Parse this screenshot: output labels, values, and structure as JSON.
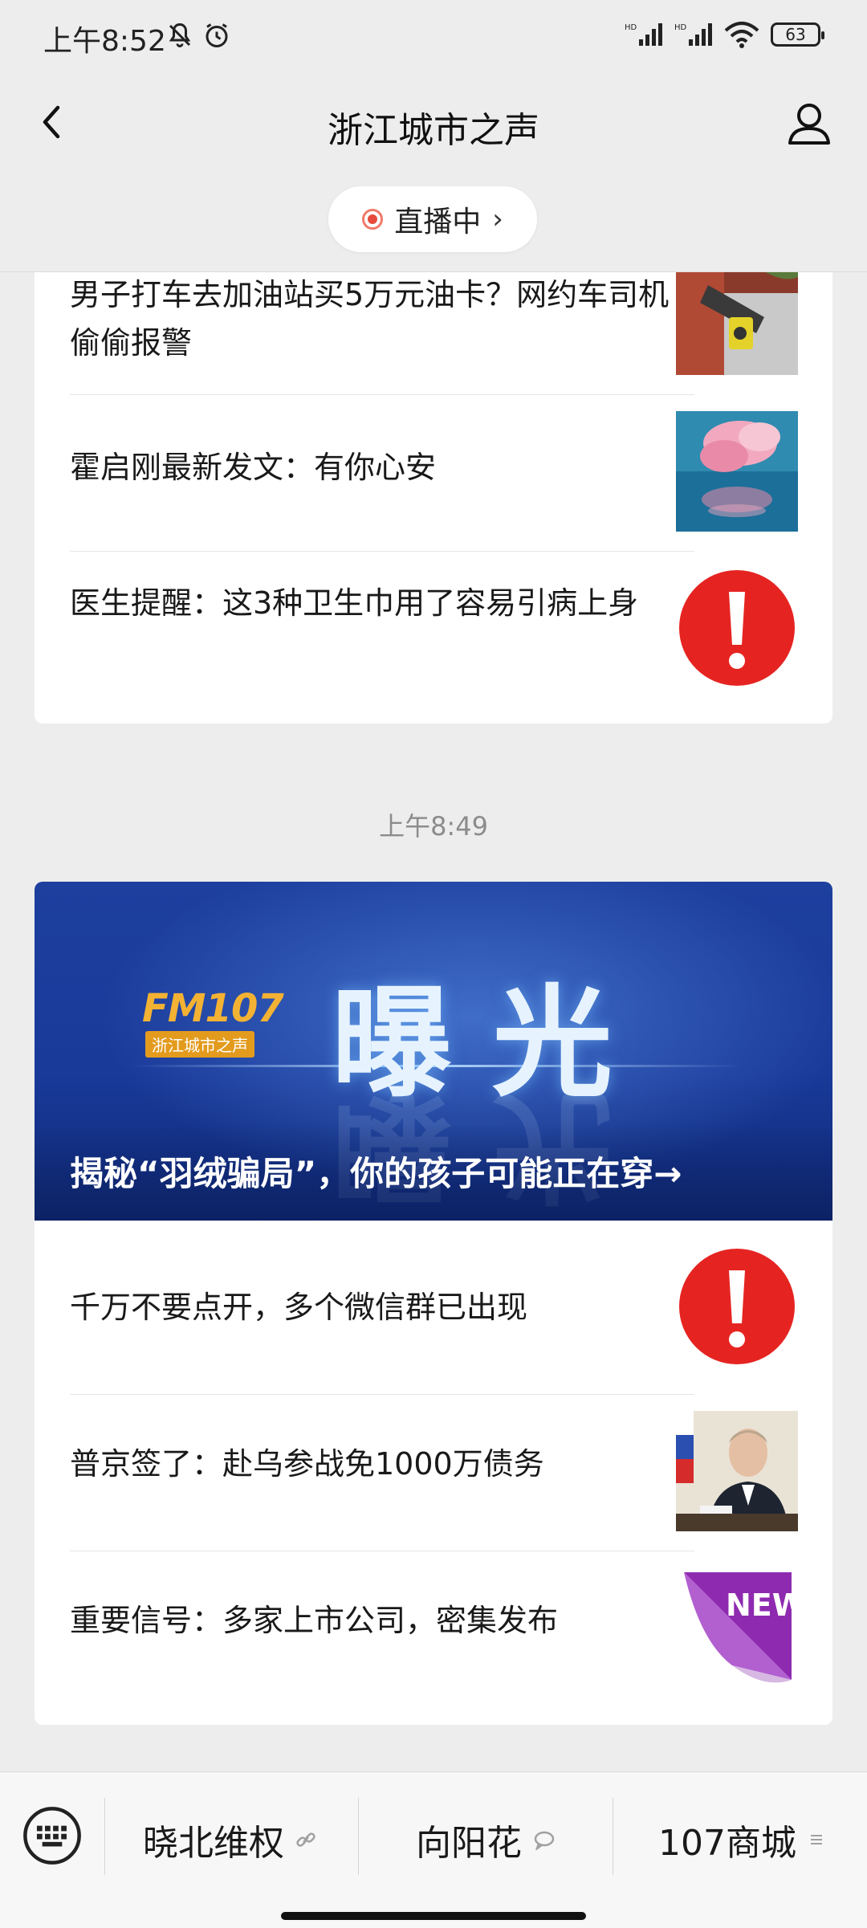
{
  "status_bar": {
    "time": "上午8:52",
    "signal_1": "ᴴᴰ",
    "signal_2": "ᴴᴰ",
    "battery": "63"
  },
  "header": {
    "title": "浙江城市之声"
  },
  "live": {
    "label": "直播中",
    "chevron": "›"
  },
  "card1": {
    "items": [
      {
        "text": "男子打车去加油站买5万元油卡？网约车司机偷偷报警",
        "thumb": "gas-pump-photo"
      },
      {
        "text": "霍启刚最新发文：有你心安",
        "thumb": "pink-flower-photo"
      },
      {
        "text": "医生提醒：这3种卫生巾用了容易引病上身",
        "thumb": "warning-icon"
      }
    ]
  },
  "timestamp": "上午8:49",
  "card2": {
    "banner": {
      "logo_text": "FM107",
      "logo_sub": "浙江城市之声",
      "headline": "曝光",
      "caption": "揭秘“羽绒骗局”，你的孩子可能正在穿→"
    },
    "items": [
      {
        "text": "千万不要点开，多个微信群已出现",
        "thumb": "warning-icon"
      },
      {
        "text": "普京签了：赴乌参战免1000万债务",
        "thumb": "putin-photo"
      },
      {
        "text": "重要信号：多家上市公司，密集发布",
        "thumb": "new-badge"
      }
    ]
  },
  "bottom_menu": {
    "items": [
      {
        "label": "晓北维权",
        "icon": "link-icon"
      },
      {
        "label": "向阳花",
        "icon": "chat-icon"
      },
      {
        "label": "107商城",
        "icon": "menu-icon"
      }
    ]
  },
  "colors": {
    "warning_red": "#e52421",
    "banner_blue": "#1d3f9e",
    "live_red": "#e64b3c"
  }
}
